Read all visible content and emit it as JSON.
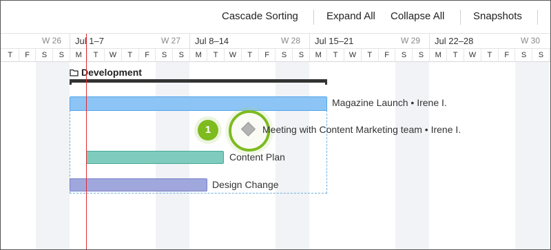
{
  "toolbar": {
    "cascade_sorting": "Cascade Sorting",
    "expand_all": "Expand All",
    "collapse_all": "Collapse All",
    "snapshots": "Snapshots"
  },
  "timeline": {
    "weeks": [
      {
        "range": "",
        "num": "W 26"
      },
      {
        "range": "Jul 1–7",
        "num": "W 27"
      },
      {
        "range": "Jul 8–14",
        "num": "W 28"
      },
      {
        "range": "Jul 15–21",
        "num": "W 29"
      },
      {
        "range": "Jul 22–28",
        "num": "W 30"
      }
    ],
    "days": [
      "T",
      "F",
      "S",
      "S",
      "M",
      "T",
      "W",
      "T",
      "F",
      "S",
      "S",
      "M",
      "T",
      "W",
      "T",
      "F",
      "S",
      "S",
      "M",
      "T",
      "W",
      "T",
      "F",
      "S",
      "S",
      "M",
      "T",
      "W",
      "T",
      "F",
      "S",
      "S"
    ]
  },
  "group": {
    "label": "Development"
  },
  "tasks": {
    "magazine": "Magazine Launch • Irene I.",
    "meeting": "Meeting with Content Marketing team • Irene I.",
    "content": "Content Plan",
    "design": "Design Change"
  },
  "hint": {
    "badge": "1"
  },
  "colors": {
    "today_line": "#e0282e",
    "magazine_bar": "#8cc4f5",
    "content_bar": "#7fcbbd",
    "design_bar": "#9fa7dc",
    "hint_ring": "#7dbb1f"
  }
}
